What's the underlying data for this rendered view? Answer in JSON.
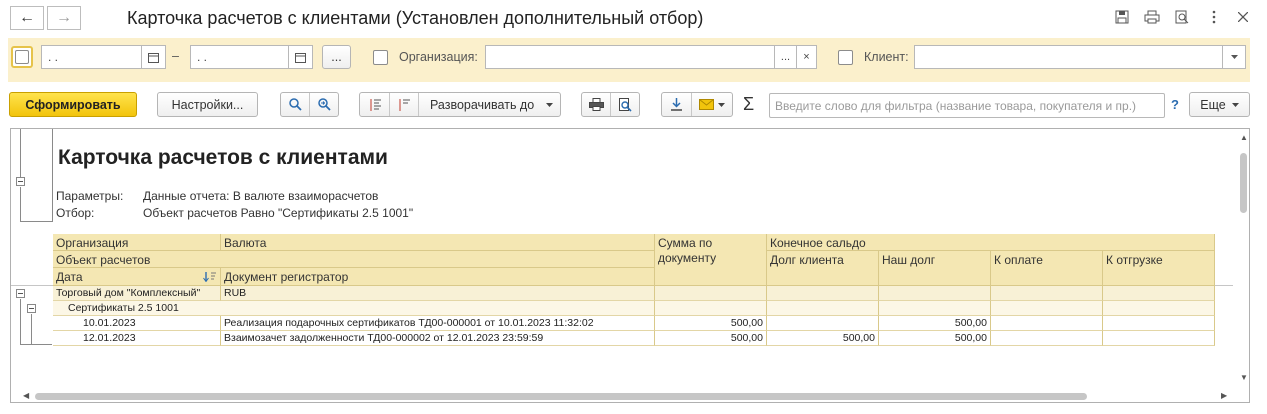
{
  "window": {
    "title": "Карточка расчетов с клиентами (Установлен дополнительный отбор)",
    "back_icon": "←",
    "forward_icon": "→"
  },
  "filters": {
    "date_from_value": " .  .",
    "date_to_value": " .  .",
    "dash": "–",
    "ellipsis": "...",
    "org_label": "Организация:",
    "org_value": "",
    "org_dots": "...",
    "org_clear": "×",
    "client_label": "Клиент:",
    "client_value": ""
  },
  "toolbar": {
    "generate_label": "Сформировать",
    "settings_label": "Настройки...",
    "expand_label": "Разворачивать до",
    "sigma": "Σ",
    "search_placeholder": "Введите слово для фильтра (название товара, покупателя и пр.)",
    "help": "?",
    "more_label": "Еще"
  },
  "report": {
    "title": "Карточка расчетов с клиентами",
    "params_label": "Параметры:",
    "params_value": "Данные отчета: В валюте взаиморасчетов",
    "filter_label": "Отбор:",
    "filter_value": "Объект расчетов Равно \"Сертификаты 2.5 1001\"",
    "headers": {
      "org": "Организация",
      "currency": "Валюта",
      "calc_object": "Объект расчетов",
      "date": "Дата",
      "doc": "Документ регистратор",
      "sum": "Сумма по документу",
      "final_balance": "Конечное сальдо",
      "client_debt": "Долг клиента",
      "our_debt": "Наш долг",
      "to_pay": "К оплате",
      "to_ship": "К отгрузке"
    },
    "group1": {
      "org": "Торговый дом \"Комплексный\"",
      "currency": "RUB"
    },
    "group2": {
      "object": "Сертификаты 2.5 1001"
    },
    "rows": [
      {
        "date": "10.01.2023",
        "doc": "Реализация подарочных сертификатов ТД00-000001 от 10.01.2023 11:32:02",
        "sum": "500,00",
        "client_debt": "",
        "our_debt": "500,00",
        "to_pay": "",
        "to_ship": ""
      },
      {
        "date": "12.01.2023",
        "doc": "Взаимозачет задолженности ТД00-000002 от 12.01.2023 23:59:59",
        "sum": "500,00",
        "client_debt": "500,00",
        "our_debt": "500,00",
        "to_pay": "",
        "to_ship": ""
      }
    ]
  }
}
